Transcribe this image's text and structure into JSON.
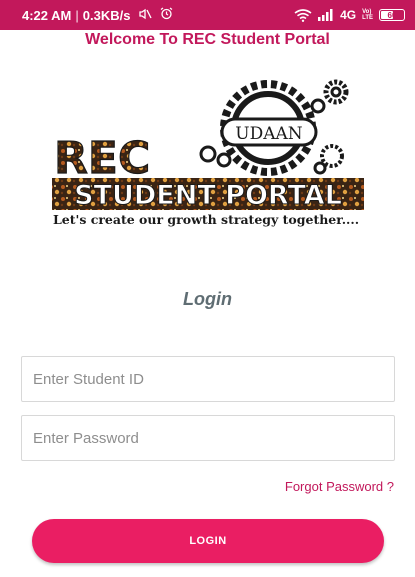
{
  "status_bar": {
    "time": "4:22 AM",
    "speed": "0.3KB/s",
    "network": "4G",
    "volte_top": "Vo)",
    "volte_bottom": "LTE",
    "battery": "60",
    "icons": [
      "mute-icon",
      "alarm-icon",
      "wifi-icon",
      "signal-icon",
      "battery-icon"
    ]
  },
  "header": {
    "welcome": "Welcome To REC Student Portal"
  },
  "logo": {
    "badge": "UDAAN",
    "line1": "REC",
    "line2": "STUDENT PORTAL",
    "tagline": "Let's create our growth strategy together...."
  },
  "form": {
    "heading": "Login",
    "student_id_placeholder": "Enter Student ID",
    "password_placeholder": "Enter Password",
    "forgot_label": "Forgot Password ?",
    "login_label": "LOGIN"
  },
  "colors": {
    "accent": "#c2185b",
    "button": "#ea1e63"
  }
}
